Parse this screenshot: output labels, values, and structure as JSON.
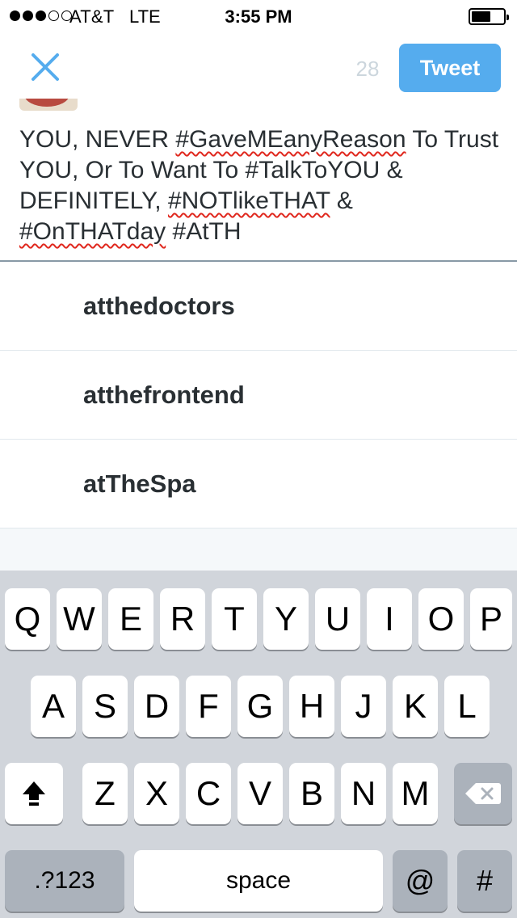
{
  "status_bar": {
    "carrier": "AT&T",
    "network": "LTE",
    "time": "3:55 PM",
    "signal_bars_filled": 3,
    "signal_bars_total": 5,
    "battery_level": 0.5
  },
  "compose": {
    "char_count": "28",
    "tweet_button": "Tweet",
    "text_segments": [
      {
        "text": "YOU, NEVER ",
        "misspelled": false
      },
      {
        "text": "#GaveMEanyReason",
        "misspelled": true
      },
      {
        "text": " To Trust YOU, Or To Want To #TalkToYOU & DEFINITELY, ",
        "misspelled": false
      },
      {
        "text": "#NOTlikeTHAT",
        "misspelled": true
      },
      {
        "text": " & ",
        "misspelled": false
      },
      {
        "text": "#OnTHATday",
        "misspelled": true
      },
      {
        "text": " #AtTH",
        "misspelled": false
      }
    ]
  },
  "suggestions": [
    "atthedoctors",
    "atthefrontend",
    "atTheSpa"
  ],
  "keyboard": {
    "row1": [
      "Q",
      "W",
      "E",
      "R",
      "T",
      "Y",
      "U",
      "I",
      "O",
      "P"
    ],
    "row2": [
      "A",
      "S",
      "D",
      "F",
      "G",
      "H",
      "J",
      "K",
      "L"
    ],
    "row3": [
      "Z",
      "X",
      "C",
      "V",
      "B",
      "N",
      "M"
    ],
    "numbers_key": ".?123",
    "space_key": "space",
    "at_key": "@",
    "hash_key": "#"
  },
  "icons": {
    "close": "close-icon",
    "shift": "shift-icon",
    "delete": "delete-icon"
  },
  "colors": {
    "accent": "#55acee",
    "misspell_underline": "#e0281e",
    "keyboard_bg": "#d1d5db"
  }
}
